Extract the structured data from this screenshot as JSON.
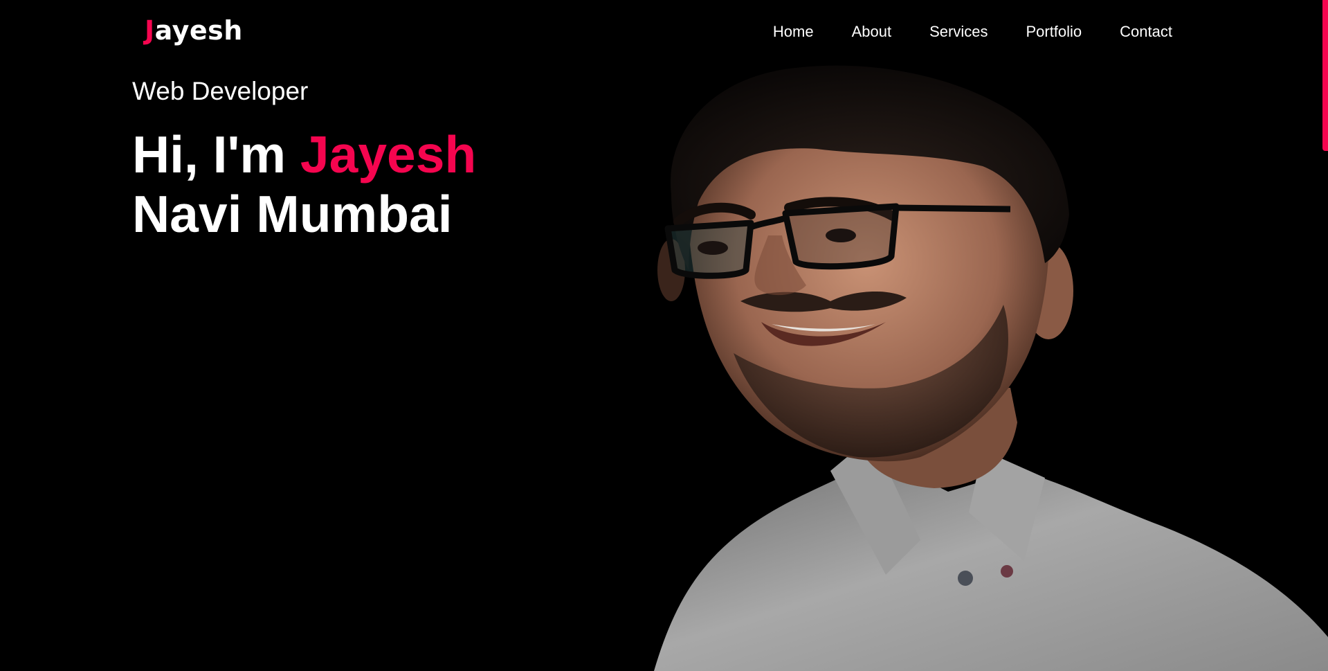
{
  "brand": {
    "logo_first_letter": "J",
    "logo_rest": "ayesh"
  },
  "nav": {
    "items": [
      {
        "label": "Home"
      },
      {
        "label": "About"
      },
      {
        "label": "Services"
      },
      {
        "label": "Portfolio"
      },
      {
        "label": "Contact"
      }
    ]
  },
  "hero": {
    "subtitle": "Web Developer",
    "greeting": "Hi, I'm",
    "name": "Jayesh",
    "location": "Navi Mumbai"
  },
  "colors": {
    "accent": "#f5054f",
    "background": "#000000",
    "text": "#ffffff"
  },
  "icons": {
    "scroll_indicator": "scrollbar-thumb"
  }
}
